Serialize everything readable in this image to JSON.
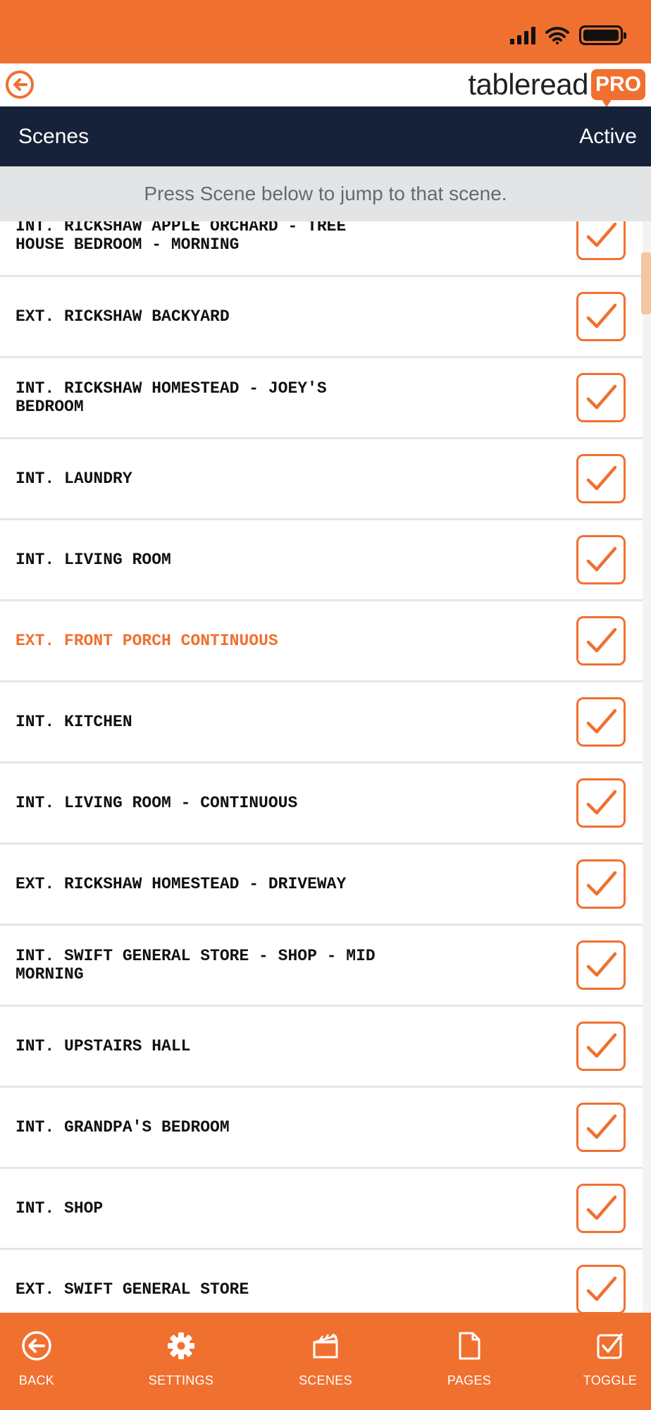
{
  "app": {
    "logo_text": "tableread",
    "logo_badge": "PRO"
  },
  "header": {
    "title": "Scenes",
    "status": "Active"
  },
  "hint": "Press Scene below to jump to that scene.",
  "scenes": [
    {
      "label": "INT. RICKSHAW APPLE ORCHARD - TREE\nHOUSE BEDROOM - MORNING",
      "checked": true,
      "active": false
    },
    {
      "label": "EXT. RICKSHAW BACKYARD",
      "checked": true,
      "active": false
    },
    {
      "label": "INT. RICKSHAW HOMESTEAD - JOEY'S\nBEDROOM",
      "checked": true,
      "active": false
    },
    {
      "label": "INT. LAUNDRY",
      "checked": true,
      "active": false
    },
    {
      "label": "INT. LIVING ROOM",
      "checked": true,
      "active": false
    },
    {
      "label": "EXT. FRONT PORCH CONTINUOUS",
      "checked": true,
      "active": true
    },
    {
      "label": "INT. KITCHEN",
      "checked": true,
      "active": false
    },
    {
      "label": "INT. LIVING ROOM - CONTINUOUS",
      "checked": true,
      "active": false
    },
    {
      "label": "EXT. RICKSHAW HOMESTEAD - DRIVEWAY",
      "checked": true,
      "active": false
    },
    {
      "label": "INT. SWIFT GENERAL STORE - SHOP - MID MORNING",
      "checked": true,
      "active": false
    },
    {
      "label": "INT. UPSTAIRS HALL",
      "checked": true,
      "active": false
    },
    {
      "label": "INT. GRANDPA'S BEDROOM",
      "checked": true,
      "active": false
    },
    {
      "label": "INT. SHOP",
      "checked": true,
      "active": false
    },
    {
      "label": "EXT. SWIFT GENERAL STORE",
      "checked": true,
      "active": false
    }
  ],
  "tabs": [
    {
      "label": "BACK",
      "icon": "back-arrow-icon"
    },
    {
      "label": "SETTINGS",
      "icon": "gear-icon"
    },
    {
      "label": "SCENES",
      "icon": "clapperboard-icon"
    },
    {
      "label": "PAGES",
      "icon": "page-icon"
    },
    {
      "label": "TOGGLE",
      "icon": "checkbox-icon"
    }
  ],
  "colors": {
    "accent": "#f07030",
    "nav": "#16213a",
    "hint_bg": "#e3e4e6"
  }
}
